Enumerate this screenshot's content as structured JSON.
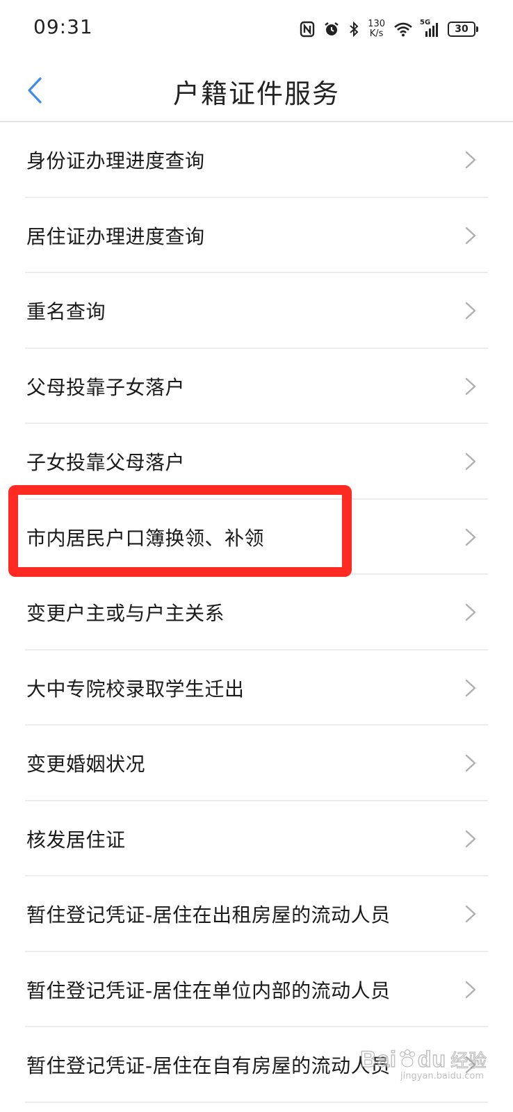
{
  "status_bar": {
    "time": "09:31",
    "net_speed_value": "130",
    "net_speed_unit": "K/s",
    "network_type": "5G",
    "battery": "30"
  },
  "header": {
    "title": "户籍证件服务"
  },
  "services": [
    {
      "label": "身份证办理进度查询"
    },
    {
      "label": "居住证办理进度查询"
    },
    {
      "label": "重名查询"
    },
    {
      "label": "父母投靠子女落户"
    },
    {
      "label": "子女投靠父母落户"
    },
    {
      "label": "市内居民户口簿换领、补领"
    },
    {
      "label": "变更户主或与户主关系"
    },
    {
      "label": "大中专院校录取学生迁出"
    },
    {
      "label": "变更婚姻状况"
    },
    {
      "label": "核发居住证"
    },
    {
      "label": "暂住登记凭证-居住在出租房屋的流动人员"
    },
    {
      "label": "暂住登记凭证-居住在单位内部的流动人员"
    },
    {
      "label": "暂住登记凭证-居住在自有房屋的流动人员"
    }
  ],
  "highlight": {
    "color": "#ff2a22",
    "target_item": "市内居民户口簿换领、补领"
  },
  "watermark": {
    "brand": "Bai",
    "brand_suffix": "du",
    "cn": "经验",
    "sub": "jingyan.baidu.com"
  },
  "colors": {
    "accent": "#3b8ee8",
    "divider": "#ececec",
    "chevron": "#b0b0b0",
    "text": "#1a1a1a"
  }
}
